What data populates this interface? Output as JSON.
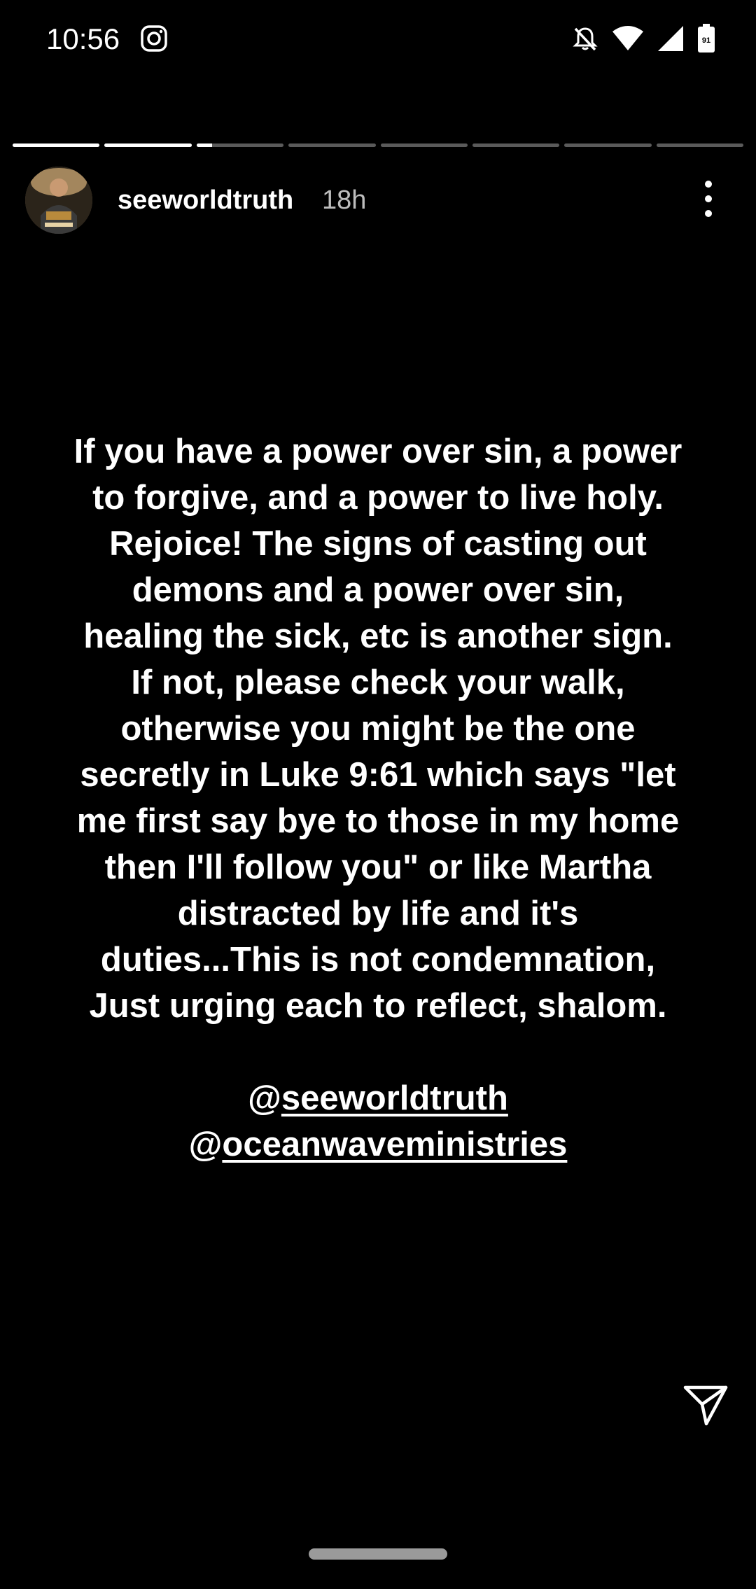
{
  "status_bar": {
    "time": "10:56",
    "left_icons": [
      "instagram-icon"
    ],
    "right_icons": [
      "notifications-off-icon",
      "wifi-icon",
      "cellular-signal-icon",
      "battery-icon"
    ],
    "battery_level": "91"
  },
  "story": {
    "progress": {
      "segment_count": 8,
      "active_index": 2,
      "active_fraction": 0.18
    },
    "author": {
      "username": "seeworldtruth",
      "time_ago": "18h"
    },
    "text": "If you have a power over sin, a power\nto forgive, and a power to live holy.\nRejoice! The signs of casting out\ndemons and a power over sin,\nhealing the sick, etc is another sign.\nIf not, please check your walk,\notherwise you might be the one\nsecretly in Luke 9:61 which says \"let\nme first say bye to those in my home\nthen I'll follow you\" or like Martha\ndistracted by life and it's\nduties...This is not condemnation,\nJust urging each to reflect, shalom.",
    "mentions": [
      {
        "at": "@",
        "handle": "seeworldtruth"
      },
      {
        "at": "@",
        "handle": "oceanwaveministries"
      }
    ]
  },
  "icons": {
    "more": "more-vertical-icon",
    "send": "send-icon"
  },
  "colors": {
    "background": "#000000",
    "text": "#ffffff",
    "muted_text": "#bdbdbd",
    "progress_track": "#5a5a5a",
    "progress_fill": "#ffffff"
  }
}
